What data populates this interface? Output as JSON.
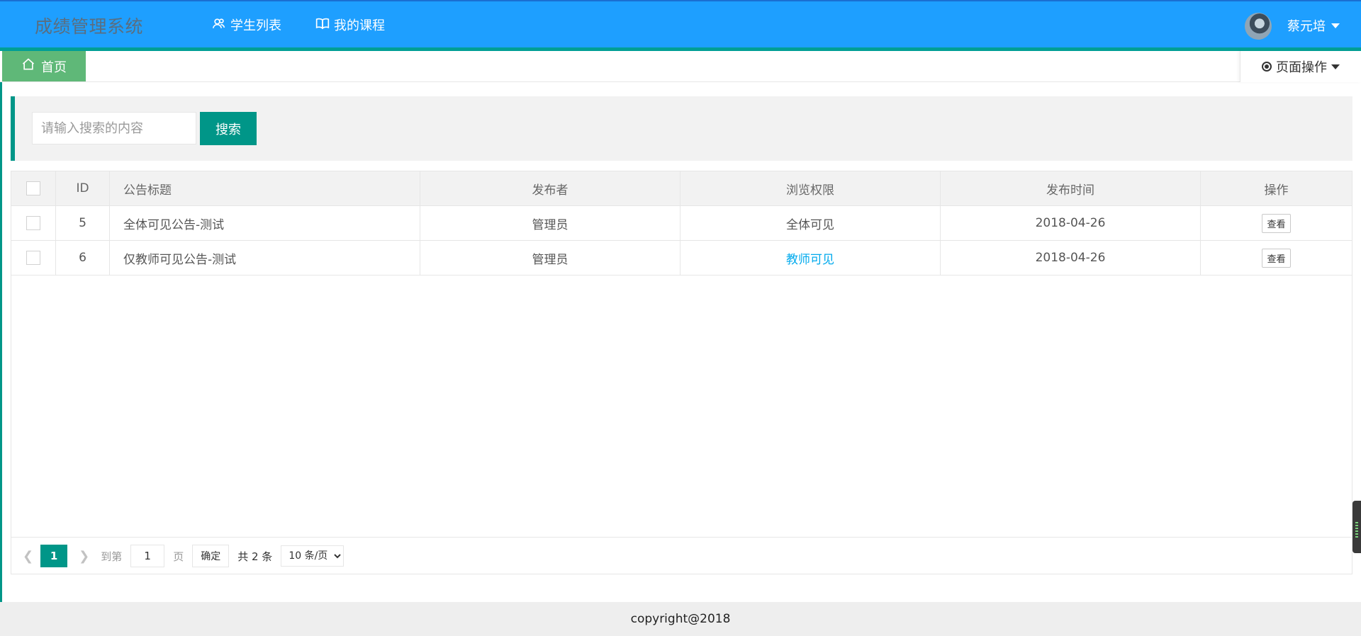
{
  "header": {
    "logo": "成绩管理系统",
    "nav": [
      {
        "label": "学生列表",
        "icon": "users-icon"
      },
      {
        "label": "我的课程",
        "icon": "book-icon"
      }
    ],
    "user_name": "蔡元培"
  },
  "tabs": {
    "home_label": "首页",
    "page_ops_label": "页面操作"
  },
  "search": {
    "placeholder": "请输入搜索的内容",
    "button_label": "搜索"
  },
  "table": {
    "columns": [
      "ID",
      "公告标题",
      "发布者",
      "浏览权限",
      "发布时间",
      "操作"
    ],
    "rows": [
      {
        "id": "5",
        "title": "全体可见公告-测试",
        "publisher": "管理员",
        "permission": "全体可见",
        "time": "2018-04-26",
        "action": "查看"
      },
      {
        "id": "6",
        "title": "仅教师可见公告-测试",
        "publisher": "管理员",
        "permission": "教师可见",
        "time": "2018-04-26",
        "action": "查看"
      }
    ]
  },
  "pager": {
    "current_page": "1",
    "goto_label": "到第",
    "goto_value": "1",
    "page_unit": "页",
    "confirm_label": "确定",
    "total_text": "共 2 条",
    "page_size": "10 条/页"
  },
  "footer": {
    "text": "copyright@2018"
  },
  "colors": {
    "header": "#1e9fff",
    "accent": "#009688",
    "home_tab": "#5fb878",
    "teacher_link": "#01aaed"
  }
}
